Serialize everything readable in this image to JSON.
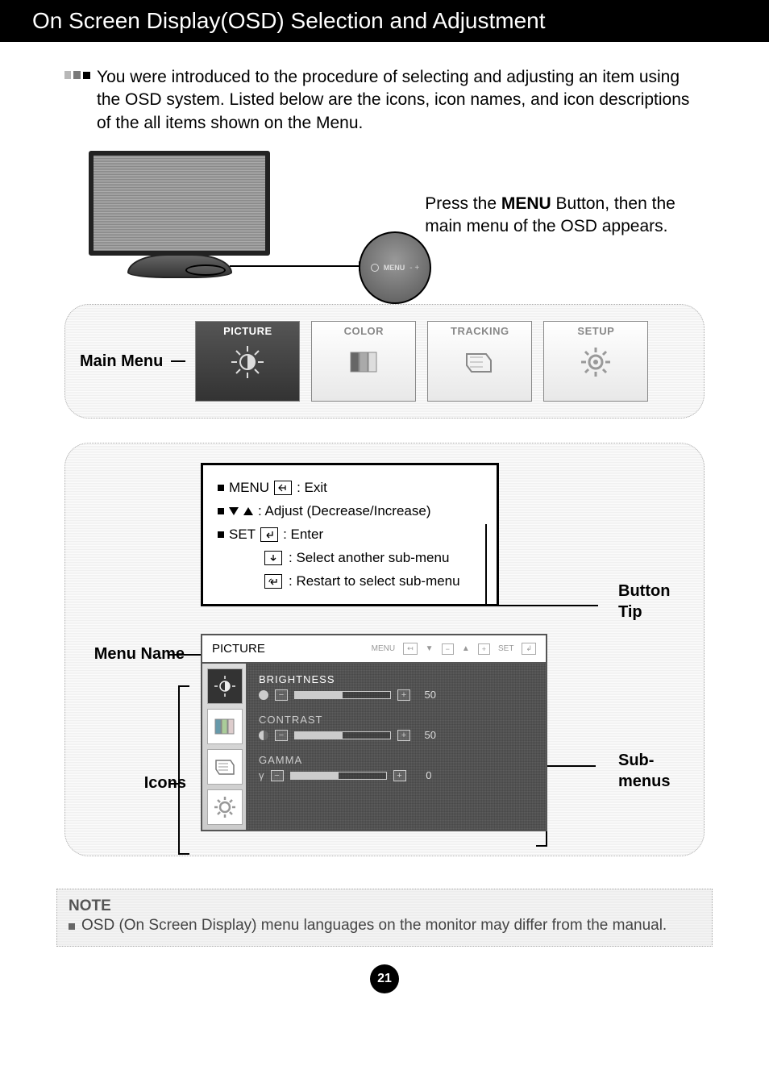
{
  "title": "On Screen Display(OSD) Selection and Adjustment",
  "intro": "You were introduced to the procedure of selecting and adjusting an item using the OSD system. Listed below are the icons, icon names, and icon descriptions of the all items shown on the Menu.",
  "monitor_circle_label": "MENU",
  "press_menu_text_1": "Press the ",
  "press_menu_bold": "MENU",
  "press_menu_text_2": " Button, then the main menu of the OSD appears.",
  "labels": {
    "main_menu": "Main Menu",
    "button_tip": "Button Tip",
    "menu_name": "Menu Name",
    "icons": "Icons",
    "sub_menus": "Sub-menus"
  },
  "main_menu_tiles": [
    {
      "title": "PICTURE",
      "active": true,
      "icon": "brightness"
    },
    {
      "title": "COLOR",
      "active": false,
      "icon": "color"
    },
    {
      "title": "TRACKING",
      "active": false,
      "icon": "tracking"
    },
    {
      "title": "SETUP",
      "active": false,
      "icon": "gear"
    }
  ],
  "button_tips": {
    "menu": "MENU",
    "menu_action": ": Exit",
    "adjust": ": Adjust (Decrease/Increase)",
    "set": "SET",
    "set_action": ": Enter",
    "sub1": ": Select another sub-menu",
    "sub2": ": Restart to select sub-menu"
  },
  "osd_window": {
    "title": "PICTURE",
    "header_keys": [
      "MENU",
      "▼",
      "▲",
      "SET"
    ],
    "items": [
      {
        "name": "BRIGHTNESS",
        "value": 50,
        "min": 0,
        "max": 100,
        "active": true
      },
      {
        "name": "CONTRAST",
        "value": 50,
        "min": 0,
        "max": 100,
        "active": false
      },
      {
        "name": "GAMMA",
        "value": 0,
        "min": -50,
        "max": 50,
        "active": false
      }
    ]
  },
  "note": {
    "title": "NOTE",
    "body": "OSD (On Screen Display) menu languages on the monitor may differ from the manual."
  },
  "page_number": "21"
}
